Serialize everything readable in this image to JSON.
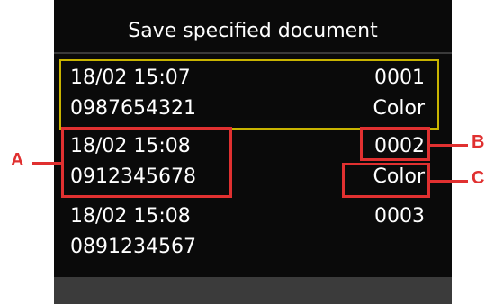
{
  "screen": {
    "title": "Save specified document",
    "items": [
      {
        "datetime": "18/02 15:07",
        "number": "0987654321",
        "doc_no": "0001",
        "mode": "Color",
        "selected": true
      },
      {
        "datetime": "18/02 15:08",
        "number": "0912345678",
        "doc_no": "0002",
        "mode": "Color",
        "selected": false
      },
      {
        "datetime": "18/02 15:08",
        "number": "0891234567",
        "doc_no": "0003",
        "mode": "",
        "selected": false
      }
    ]
  },
  "callouts": {
    "a": "A",
    "b": "B",
    "c": "C"
  },
  "colors": {
    "screen_bg": "#0a0a0a",
    "selection": "#c8b400",
    "callout": "#e03030"
  }
}
